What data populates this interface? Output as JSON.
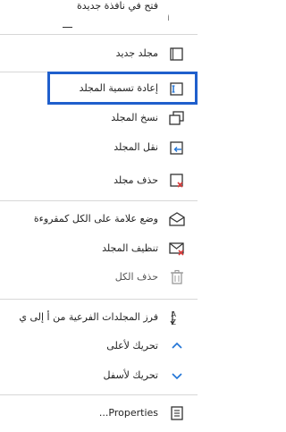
{
  "menu": {
    "items": [
      {
        "id": "open-new-window",
        "label": "فتح في نافذة جديدة",
        "icon": "open-new-window-icon"
      },
      {
        "id": "new-folder",
        "label": "مجلد جديد",
        "icon": "new-folder-icon"
      },
      {
        "id": "rename-folder",
        "label": "إعادة تسمية المجلد",
        "icon": "rename-folder-icon"
      },
      {
        "id": "copy-folder",
        "label": "نسخ المجلد",
        "icon": "copy-folder-icon"
      },
      {
        "id": "move-folder",
        "label": "نقل المجلد",
        "icon": "move-folder-icon"
      },
      {
        "id": "delete-folder",
        "label": "حذف مجلد",
        "icon": "delete-folder-icon"
      },
      {
        "id": "mark-all-read",
        "label": "وضع علامة على الكل كمقروءة",
        "icon": "mark-read-envelope-icon"
      },
      {
        "id": "clean-folder",
        "label": "تنظيف المجلد",
        "icon": "clean-folder-icon"
      },
      {
        "id": "delete-all",
        "label": "حذف الكل",
        "icon": "delete-all-icon"
      },
      {
        "id": "sort-subfolders",
        "label": "فرز المجلدات الفرعية من أ إلى ي",
        "icon": "sort-az-icon"
      },
      {
        "id": "move-up",
        "label": "تحريك لأعلى",
        "icon": "chevron-up-icon"
      },
      {
        "id": "move-down",
        "label": "تحريك لأسفل",
        "icon": "chevron-down-icon"
      },
      {
        "id": "properties",
        "label": "Properties...",
        "icon": "properties-icon"
      }
    ]
  },
  "colors": {
    "highlight_border": "#1f5fcc",
    "icon_accent_blue": "#1f73d6",
    "icon_accent_red": "#d83b3b",
    "icon_stroke": "#333333"
  }
}
